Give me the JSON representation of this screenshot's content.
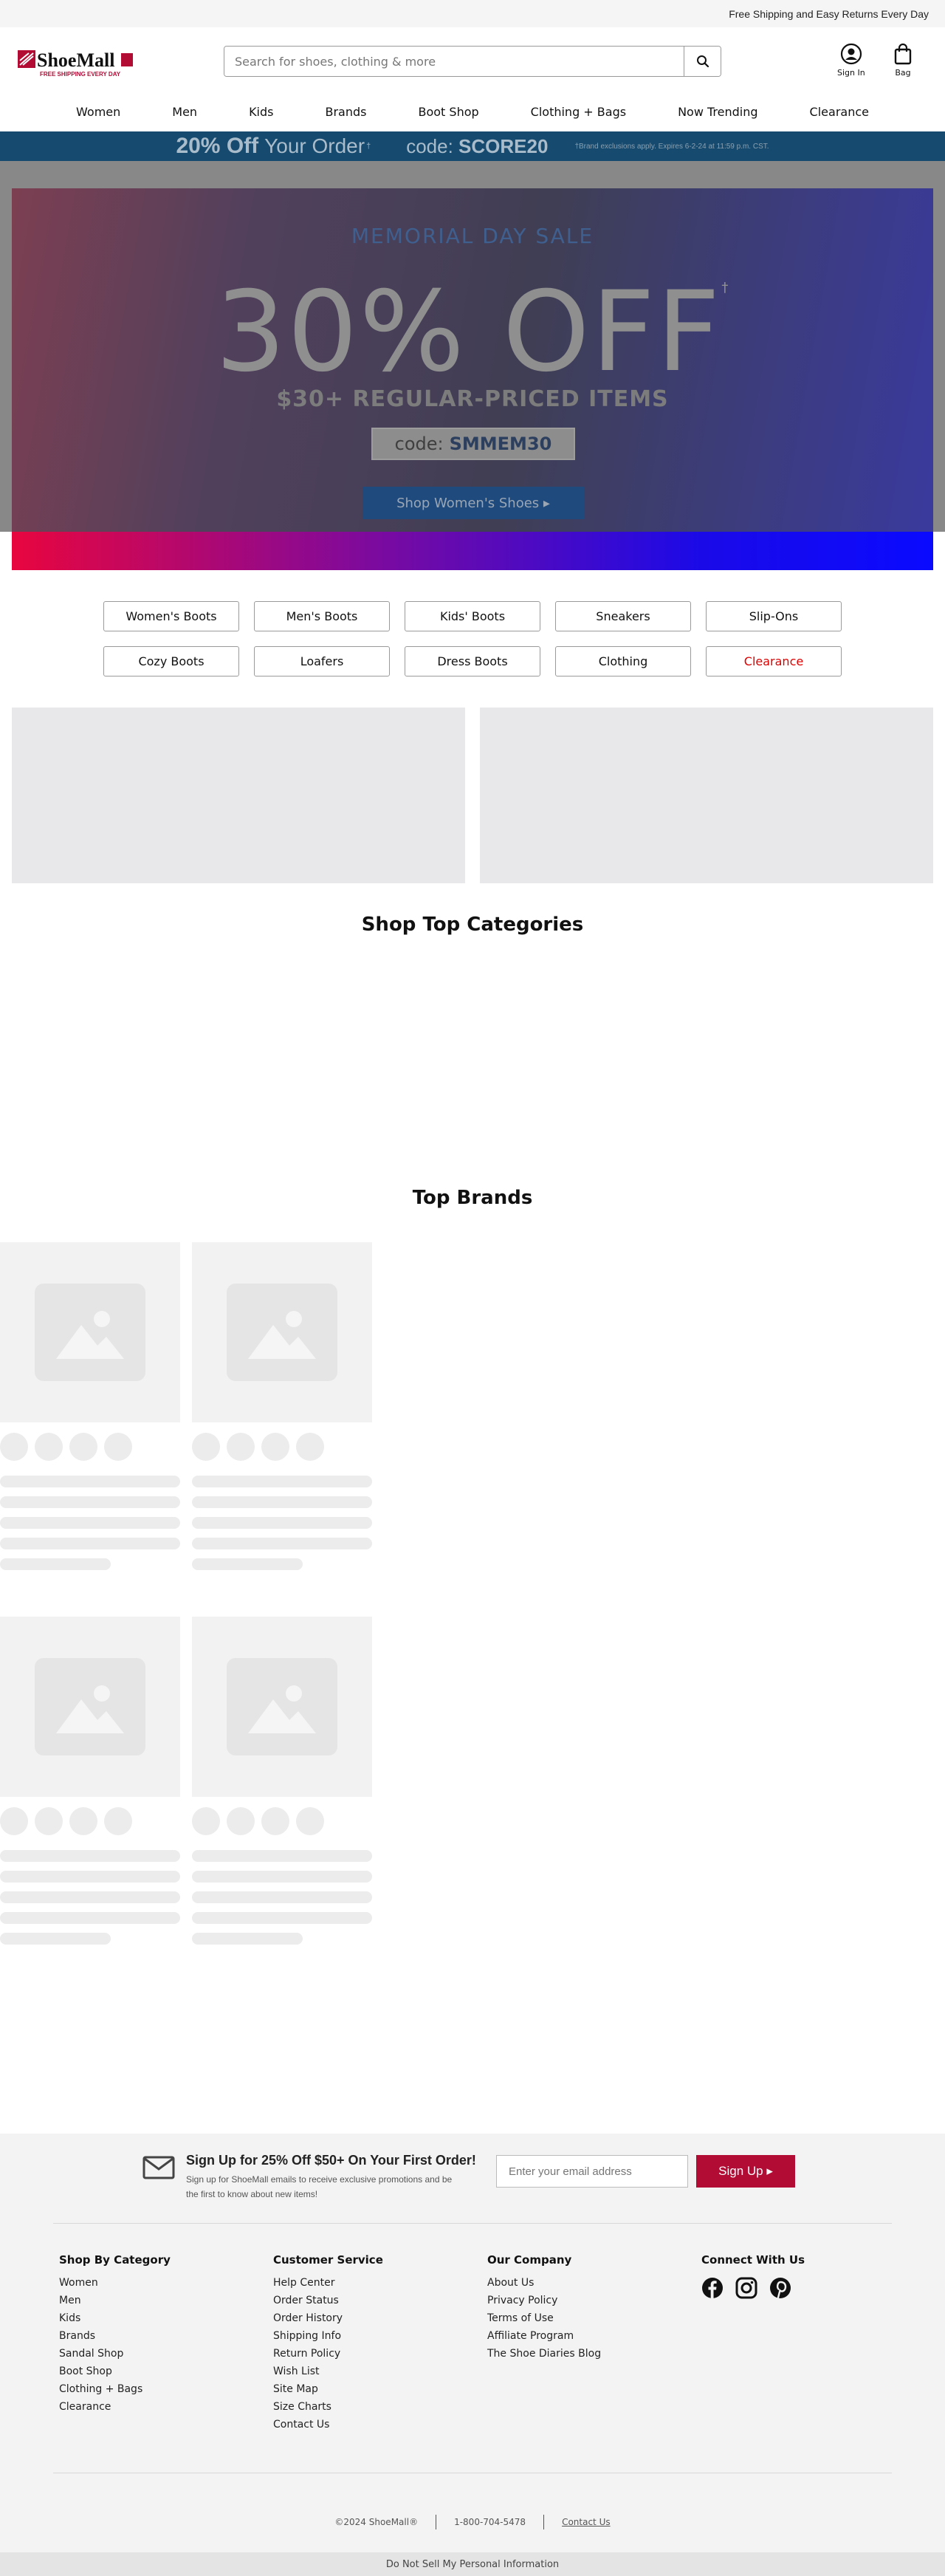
{
  "topbar": {
    "text": "Free Shipping and Easy Returns Every Day"
  },
  "logo": {
    "name": "ShoeMall",
    "tagline": "FREE SHIPPING EVERY DAY",
    "icon": "shoemall-logo-icon",
    "brand_color": "#b20c35"
  },
  "search": {
    "placeholder": "Search for shoes, clothing & more",
    "icon": "search-icon"
  },
  "account": {
    "signin_label": "Sign In",
    "bag_label": "Bag"
  },
  "nav": [
    "Women",
    "Men",
    "Kids",
    "Brands",
    "Boot Shop",
    "Clothing + Bags",
    "Now Trending",
    "Clearance"
  ],
  "promo_strip": {
    "amount": "20% Off",
    "text": "Your Order",
    "dagger": "†",
    "code_label": "code:",
    "code": "SCORE20",
    "fine_print": "†Brand exclusions apply. Expires 6-2-24 at 11:59 p.m. CST.",
    "bg_color": "#164a6e"
  },
  "hero": {
    "eyebrow": "MEMORIAL DAY SALE",
    "headline": "30% OFF",
    "dagger": "†",
    "sub": "$30+ REGULAR-PRICED ITEMS",
    "code_label": "code:",
    "code": "SMMEM30",
    "cta": "Shop Women's Shoes ▸"
  },
  "category_pills": [
    {
      "label": "Women's Boots"
    },
    {
      "label": "Men's Boots"
    },
    {
      "label": "Kids' Boots"
    },
    {
      "label": "Sneakers"
    },
    {
      "label": "Slip-Ons"
    },
    {
      "label": "Cozy Boots"
    },
    {
      "label": "Loafers"
    },
    {
      "label": "Dress Boots"
    },
    {
      "label": "Clothing"
    },
    {
      "label": "Clearance",
      "highlight": "#dd0000"
    }
  ],
  "sections": {
    "top_categories": "Shop Top Categories",
    "top_brands": "Top Brands"
  },
  "footer": {
    "signup": {
      "headline": "Sign Up for 25% Off $50+ On Your First Order!",
      "body": "Sign up for ShoeMall emails to receive exclusive promotions and be the first to know about new items!",
      "email_placeholder": "Enter your email address",
      "button": "Sign Up ▸"
    },
    "columns": [
      {
        "title": "Shop By Category",
        "links": [
          "Women",
          "Men",
          "Kids",
          "Brands",
          "Sandal Shop",
          "Boot Shop",
          "Clothing + Bags",
          "Clearance"
        ]
      },
      {
        "title": "Customer Service",
        "links": [
          "Help Center",
          "Order Status",
          "Order History",
          "Shipping Info",
          "Return Policy",
          "Wish List",
          "Site Map",
          "Size Charts",
          "Contact Us"
        ]
      },
      {
        "title": "Our Company",
        "links": [
          "About Us",
          "Privacy Policy",
          "Terms of Use",
          "Affiliate Program",
          "The Shoe Diaries Blog"
        ]
      }
    ],
    "connect": {
      "title": "Connect With Us",
      "icons": [
        "facebook-icon",
        "instagram-icon",
        "pinterest-icon"
      ]
    },
    "legal": {
      "copyright": "©2024 ShoeMall®",
      "phone": "1-800-704-5478",
      "contact": "Contact Us"
    },
    "do_not_sell": "Do Not Sell My Personal Information"
  }
}
